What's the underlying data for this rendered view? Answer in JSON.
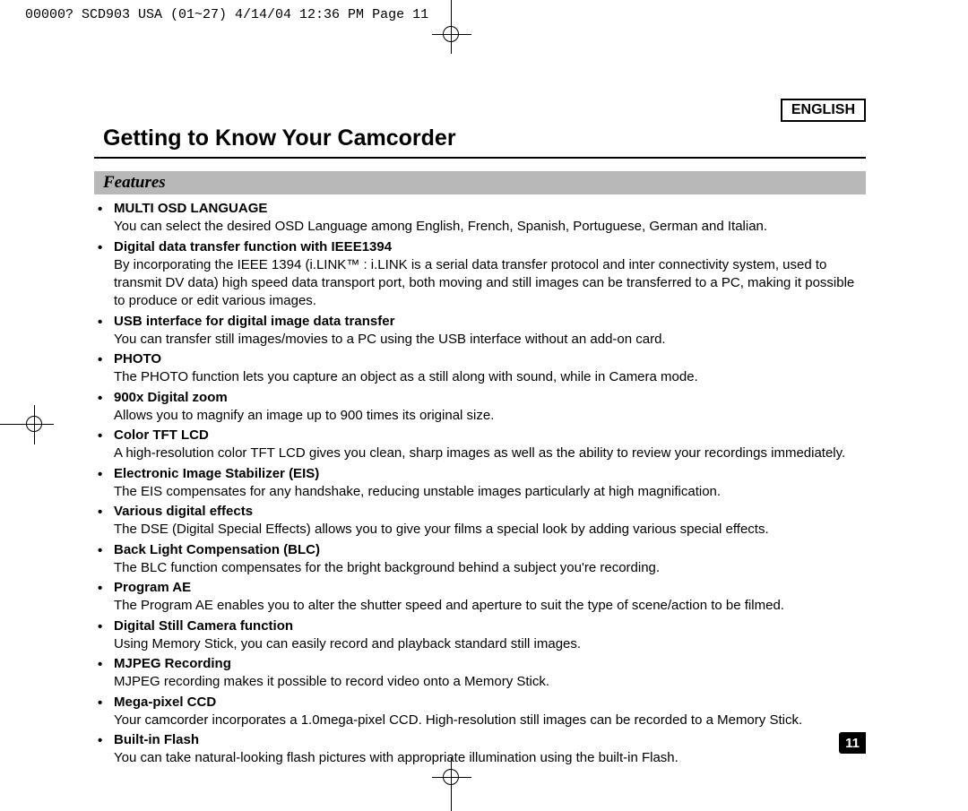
{
  "header_line": "00000? SCD903 USA (01~27)  4/14/04 12:36 PM  Page 11",
  "language_badge": "ENGLISH",
  "main_title": "Getting to Know Your Camcorder",
  "subtitle": "Features",
  "page_number": "11",
  "features": [
    {
      "title": "MULTI OSD LANGUAGE",
      "body": "You can select the desired OSD Language among English, French, Spanish, Portuguese, German and Italian."
    },
    {
      "title": "Digital data transfer function with IEEE1394",
      "body": "By incorporating the IEEE 1394 (i.LINK™ : i.LINK is a serial data transfer protocol and inter connectivity system, used to transmit DV data) high speed data transport port, both moving and still images can be transferred to a PC, making it possible to produce or edit various images."
    },
    {
      "title": "USB interface for digital image data transfer",
      "body": "You can transfer still images/movies to a PC using the USB interface without an add-on card."
    },
    {
      "title": "PHOTO",
      "body": "The PHOTO function lets you capture an object as a still along with sound, while in Camera mode."
    },
    {
      "title": "900x Digital zoom",
      "body": "Allows you to magnify an image up to 900 times its original size."
    },
    {
      "title": "Color TFT LCD",
      "body": "A high-resolution color TFT LCD gives you clean, sharp images as well as the ability to review your recordings immediately."
    },
    {
      "title": "Electronic Image Stabilizer (EIS)",
      "body": "The EIS compensates for any handshake, reducing unstable images particularly at high magnification."
    },
    {
      "title": "Various digital effects",
      "body": "The DSE (Digital Special Effects) allows you to give your films a special look by adding various special effects."
    },
    {
      "title": "Back Light Compensation (BLC)",
      "body": "The BLC function compensates for the bright background behind a subject you're recording."
    },
    {
      "title": "Program AE",
      "body": "The Program AE enables you to alter the shutter speed and aperture to suit the type of scene/action to be filmed."
    },
    {
      "title": "Digital Still Camera function",
      "body": "Using Memory Stick, you can easily record and playback standard still images."
    },
    {
      "title": "MJPEG Recording",
      "body": "MJPEG recording makes it possible to record video onto a Memory Stick."
    },
    {
      "title": "Mega-pixel CCD",
      "body": "Your camcorder incorporates a 1.0mega-pixel CCD. High-resolution still images can be recorded to a Memory Stick."
    },
    {
      "title": "Built-in Flash",
      "body": "You can take natural-looking flash pictures with appropriate illumination using the built-in Flash."
    }
  ]
}
